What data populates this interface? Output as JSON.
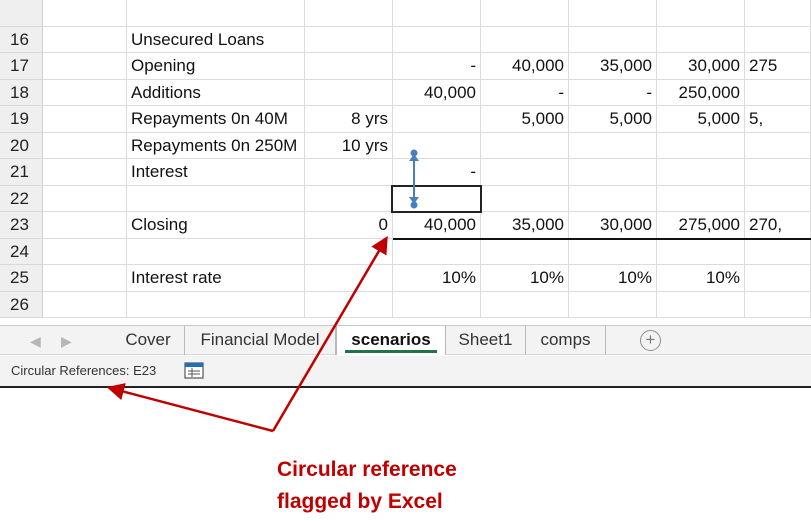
{
  "rows": [
    {
      "num": "16",
      "label": "Unsecured Loans",
      "d": "",
      "e": "",
      "f": "",
      "g": "",
      "h": "",
      "i": ""
    },
    {
      "num": "17",
      "label": "Opening",
      "d": "",
      "e": "-",
      "f": "40,000",
      "g": "35,000",
      "h": "30,000",
      "i": "275"
    },
    {
      "num": "18",
      "label": "Additions",
      "d": "",
      "e": "40,000",
      "f": "-",
      "g": "-",
      "h": "250,000",
      "i": ""
    },
    {
      "num": "19",
      "label": "Repayments 0n 40M",
      "d": "8 yrs",
      "e": "",
      "f": "5,000",
      "g": "5,000",
      "h": "5,000",
      "i": "5,"
    },
    {
      "num": "20",
      "label": "Repayments 0n 250M",
      "d": "10 yrs",
      "e": "",
      "f": "",
      "g": "",
      "h": "",
      "i": ""
    },
    {
      "num": "21",
      "label": "Interest",
      "d": "",
      "e": "-",
      "f": "",
      "g": "",
      "h": "",
      "i": ""
    },
    {
      "num": "22",
      "label": "",
      "d": "",
      "e": "",
      "f": "",
      "g": "",
      "h": "",
      "i": ""
    },
    {
      "num": "23",
      "label": "Closing",
      "d": "0",
      "e": "40,000",
      "f": "35,000",
      "g": "30,000",
      "h": "275,000",
      "i": "270,"
    },
    {
      "num": "24",
      "label": "",
      "d": "",
      "e": "",
      "f": "",
      "g": "",
      "h": "",
      "i": ""
    },
    {
      "num": "25",
      "label": "Interest rate",
      "d": "",
      "e": "10%",
      "f": "10%",
      "g": "10%",
      "h": "10%",
      "i": ""
    },
    {
      "num": "26",
      "label": "",
      "d": "",
      "e": "",
      "f": "",
      "g": "",
      "h": "",
      "i": ""
    }
  ],
  "tabs": {
    "items": [
      {
        "id": "cover",
        "label": "Cover",
        "active": false
      },
      {
        "id": "financial-model",
        "label": "Financial Model",
        "active": false
      },
      {
        "id": "scenarios",
        "label": "scenarios",
        "active": true
      },
      {
        "id": "sheet1",
        "label": "Sheet1",
        "active": false
      },
      {
        "id": "comps",
        "label": "comps",
        "active": false
      }
    ],
    "add_symbol": "+",
    "prev_symbol": "◀",
    "next_symbol": "▶"
  },
  "status": {
    "circular_text": "Circular References: E23",
    "icon": "page-layout-icon"
  },
  "annotation": {
    "line1": "Circular reference",
    "line2": "flagged by Excel",
    "color": "#c00000"
  }
}
